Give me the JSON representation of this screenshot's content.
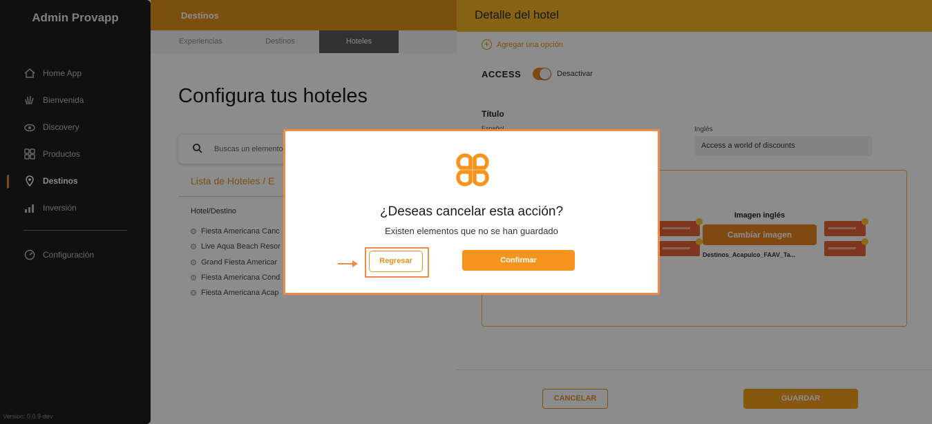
{
  "app": {
    "brand": "Admin Provapp",
    "version": "Version: 0.0.9-dev"
  },
  "sidebar": {
    "items": [
      {
        "label": "Home App",
        "icon": "home-icon"
      },
      {
        "label": "Bienvenida",
        "icon": "wave-icon"
      },
      {
        "label": "Discovery",
        "icon": "eye-icon"
      },
      {
        "label": "Productos",
        "icon": "grid-icon"
      },
      {
        "label": "Destinos",
        "icon": "location-pin-icon",
        "active": true
      },
      {
        "label": "Inversión",
        "icon": "bar-chart-icon"
      },
      {
        "label": "Configuración",
        "icon": "settings-icon"
      }
    ]
  },
  "header": {
    "title": "Destinos"
  },
  "tabs": [
    {
      "label": "Experiencias"
    },
    {
      "label": "Destinos"
    },
    {
      "label": "Hoteles",
      "active": true
    }
  ],
  "main": {
    "page_title": "Configura tus hoteles",
    "search_placeholder": "Buscas un elemento",
    "list_title": "Lista de Hoteles / E",
    "column_header": "Hotel/Destino",
    "hotels": [
      "Fiesta Americana Canc",
      "Live Aqua Beach Resor",
      "Grand Fiesta Americar",
      "Fiesta Americana Cond",
      "Fiesta Americana Acap"
    ]
  },
  "panel": {
    "title": "Detalle del hotel",
    "add_option": "Agregar una opción",
    "access_label": "ACCESS",
    "toggle_label": "Desactivar",
    "toggle_on": true,
    "field_title": "Título",
    "sublabel_es": "Español",
    "sublabel_en": "Inglés",
    "input_en_value": "Access a world of discounts",
    "image_en_label": "Imagen inglés",
    "change_image_button": "Cambiar imagen",
    "filename": "Destinos_Acapulco_FAAV_Ta...",
    "cancel_button": "CANCELAR",
    "save_button": "GUARDAR"
  },
  "modal": {
    "title": "¿Deseas cancelar esta acción?",
    "subtitle": "Existen elementos que no se han guardado",
    "back_button": "Regresar",
    "confirm_button": "Confirmar"
  },
  "colors": {
    "accent": "#e0921c",
    "panel_header": "#f5b324",
    "sidebar_bg": "#1e1e1e",
    "highlight": "#f08a44"
  }
}
